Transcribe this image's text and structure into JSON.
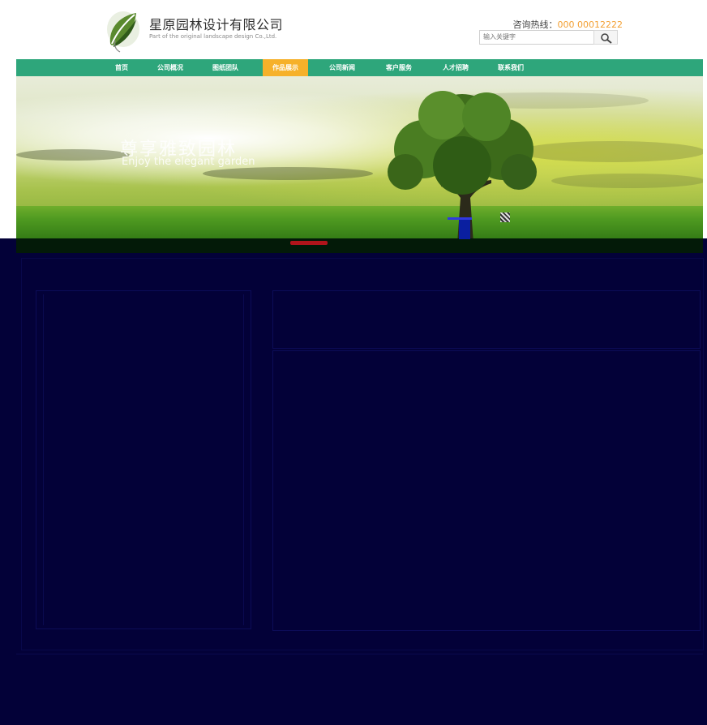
{
  "header": {
    "company_name_cn": "星原园林设计有限公司",
    "company_name_en": "Part of the original landscape design Co.,Ltd.",
    "hotline_label": "咨询热线：",
    "hotline_number": "000 00012222",
    "search_placeholder": "输入关键字"
  },
  "nav": {
    "items": [
      {
        "label": "首页"
      },
      {
        "label": "公司概况"
      },
      {
        "label": "图纸团队"
      },
      {
        "label": "作品展示"
      },
      {
        "label": "公司新闻"
      },
      {
        "label": "客户服务"
      },
      {
        "label": "人才招聘"
      },
      {
        "label": "联系我们"
      }
    ],
    "active_index": 3,
    "bg_color": "#2ea67b",
    "active_color": "#f6b12a"
  },
  "banner": {
    "title_cn": "尊享雅致园林",
    "title_en": "Enjoy the elegant garden"
  },
  "content": {
    "section_title": "",
    "left_panel_title": "",
    "right_top_title": "",
    "right_panel_title": ""
  },
  "colors": {
    "page_dark": "#030138",
    "accent_orange": "#f3a033",
    "slider_active": "#b0141b"
  }
}
